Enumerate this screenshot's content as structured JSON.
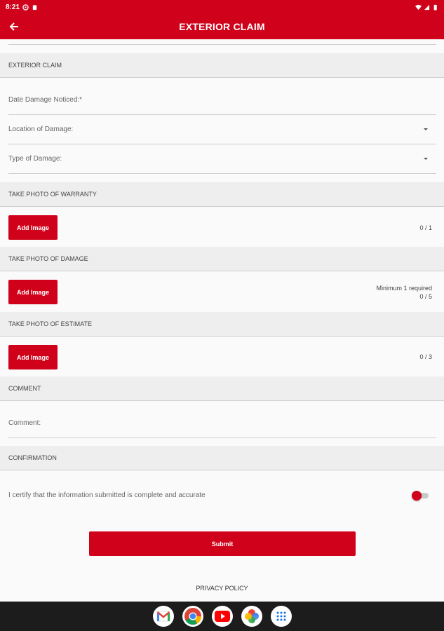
{
  "status_bar": {
    "time": "8:21"
  },
  "app_bar": {
    "title": "EXTERIOR CLAIM"
  },
  "sections": {
    "exterior_claim": {
      "header": "EXTERIOR CLAIM"
    },
    "warranty": {
      "header": "TAKE PHOTO OF WARRANTY",
      "button_label": "Add Image",
      "count": "0 / 1"
    },
    "damage": {
      "header": "TAKE PHOTO OF DAMAGE",
      "button_label": "Add Image",
      "note": "Minimum 1 required",
      "count": "0 / 5"
    },
    "estimate": {
      "header": "TAKE PHOTO OF ESTIMATE",
      "button_label": "Add Image",
      "count": "0 / 3"
    },
    "comment": {
      "header": "COMMENT"
    },
    "confirmation": {
      "header": "CONFIRMATION",
      "certify_label": "I certify that the information submitted is complete and accurate",
      "certified": false
    }
  },
  "fields": {
    "date_damage_noticed": {
      "label": "Date Damage Noticed:*"
    },
    "location_of_damage": {
      "label": "Location of Damage:"
    },
    "type_of_damage": {
      "label": "Type of Damage:"
    },
    "comment": {
      "label": "Comment:"
    }
  },
  "submit_label": "Submit",
  "privacy_label": "PRIVACY POLICY",
  "nav_apps": [
    "gmail-icon",
    "chrome-icon",
    "youtube-icon",
    "photos-icon",
    "app-drawer-icon"
  ],
  "colors": {
    "brand": "#d0021b",
    "nav_bar": "#1c1c1c",
    "section_bg": "#eeeeee",
    "page_bg": "#fafafa"
  }
}
